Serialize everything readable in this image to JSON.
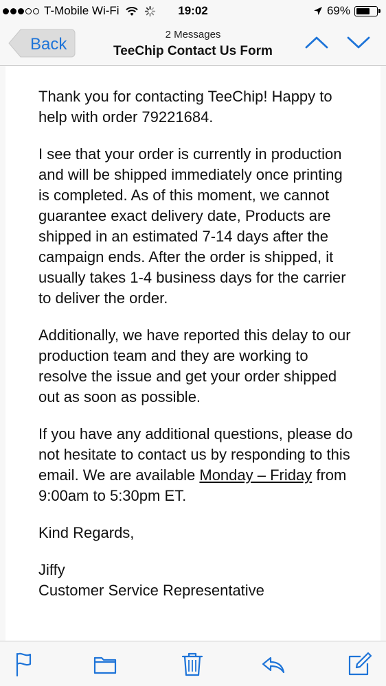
{
  "status_bar": {
    "carrier": "T-Mobile Wi-Fi",
    "time": "19:02",
    "battery_percent": "69%",
    "battery_level": 0.69,
    "signal_bars": 3,
    "signal_total": 5,
    "icons": [
      "wifi-icon",
      "spinner-icon",
      "location-arrow-icon",
      "battery-icon"
    ]
  },
  "nav": {
    "back_label": "Back",
    "subtitle": "2 Messages",
    "title": "TeeChip Contact Us Form",
    "accent_color": "#1e74d8",
    "icons": [
      "previous-message-icon",
      "next-message-icon"
    ]
  },
  "message": {
    "para1": "Thank you for contacting TeeChip! Happy to help with order 79221684.",
    "para2": "I see that your order is currently in production and will be shipped immediately once printing is completed. As of this moment, we cannot guarantee exact delivery date, Products are shipped in an estimated 7-14 days after the campaign ends. After the order is shipped, it usually takes 1-4 business days for the carrier to deliver the order.",
    "para3": "Additionally, we have reported this delay to our production team and they are working to resolve the issue and get your order shipped out as soon as possible.",
    "para4_before": "If you have any additional questions, please do not hesitate to contact us by responding to this email. We are available ",
    "para4_link": "Monday – Friday",
    "para4_after": " from 9:00am to 5:30pm ET.",
    "closing": "Kind Regards,",
    "signature_name": "Jiffy",
    "signature_title": "Customer Service Representative"
  },
  "toolbar": {
    "icons": [
      "flag-icon",
      "folder-icon",
      "trash-icon",
      "reply-icon",
      "compose-icon"
    ]
  }
}
